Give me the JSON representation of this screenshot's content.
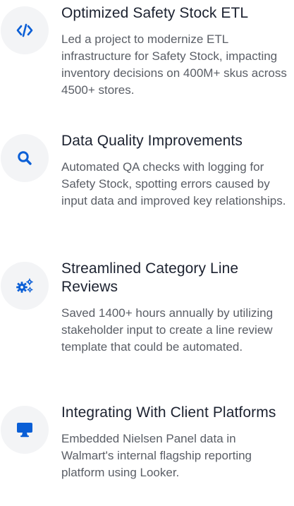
{
  "features": [
    {
      "icon": "code-icon",
      "title": "Optimized Safety Stock ETL",
      "description": "Led a project to modernize ETL infrastructure for Safety Stock, impacting inventory decisions on 400M+ skus across 4500+ stores."
    },
    {
      "icon": "search-icon",
      "title": "Data Quality Improvements",
      "description": "Automated QA checks with logging for Safety Stock, spotting errors caused by input data and improved key relationships."
    },
    {
      "icon": "gears-icon",
      "title": "Streamlined Category Line Reviews",
      "description": "Saved 1400+ hours annually by utilizing stakeholder input to create a line review template that could be automated."
    },
    {
      "icon": "desktop-icon",
      "title": "Integrating With Client Platforms",
      "description": "Embedded Nielsen Panel data in Walmart's internal flagship reporting platform using Looker."
    }
  ],
  "colors": {
    "accent": "#0b5fd6",
    "icon_background": "#f3f4f6",
    "title": "#1c2230",
    "body_text": "#5a5e66"
  }
}
